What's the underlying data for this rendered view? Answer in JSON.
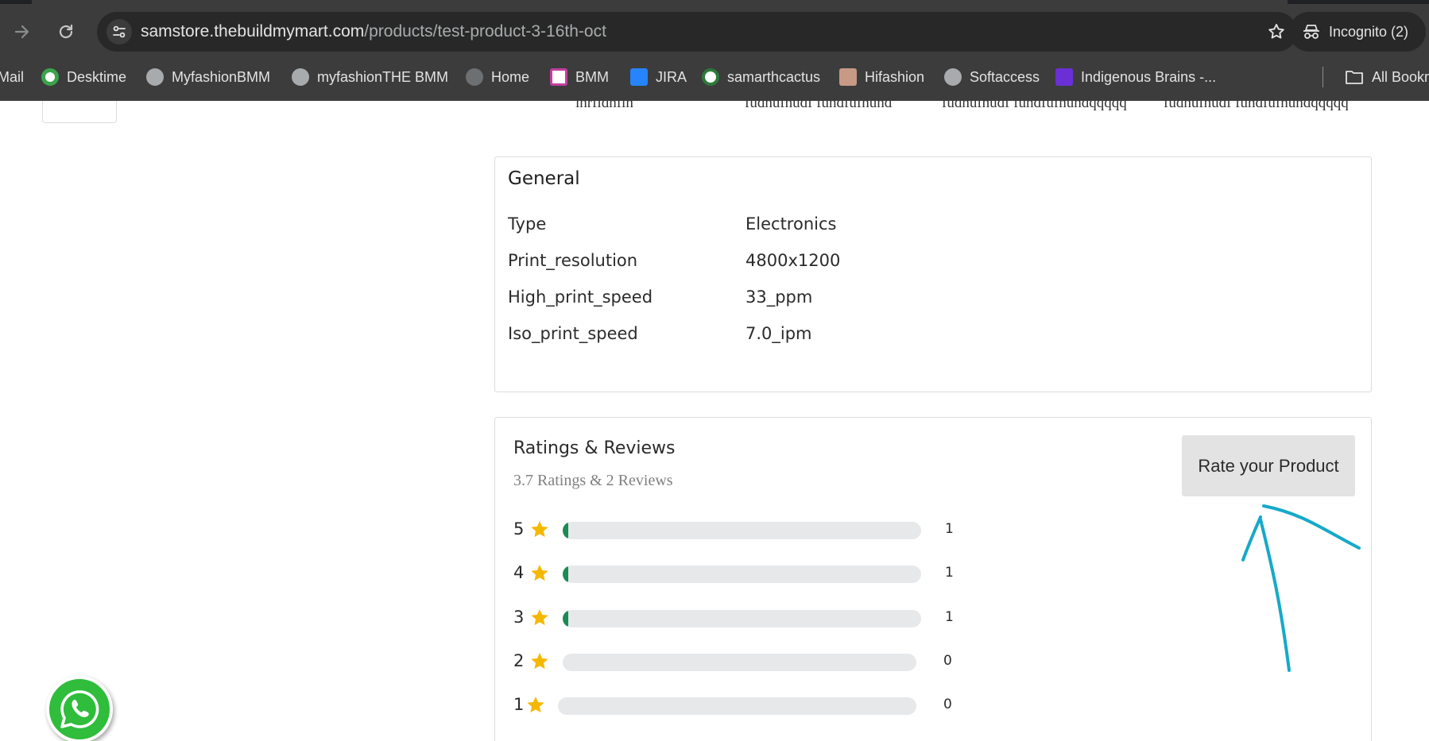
{
  "browser": {
    "url_host": "samstore.thebuildmymart.com",
    "url_path": "/products/test-product-3-16th-oct",
    "incognito_label": "Incognito (2)",
    "bookmarks": [
      {
        "label": "Mail",
        "icon": "mail-icon"
      },
      {
        "label": "Desktime",
        "icon": "desktime-icon"
      },
      {
        "label": "MyfashionBMM",
        "icon": "globe-icon"
      },
      {
        "label": "myfashionTHE BMM",
        "icon": "globe-icon"
      },
      {
        "label": "Home",
        "icon": "globe-icon"
      },
      {
        "label": "BMM",
        "icon": "bmm-icon"
      },
      {
        "label": "JIRA",
        "icon": "jira-icon"
      },
      {
        "label": "samarthcactus",
        "icon": "cactus-icon"
      },
      {
        "label": "Hifashion",
        "icon": "hifashion-icon"
      },
      {
        "label": "Softaccess",
        "icon": "globe-icon"
      },
      {
        "label": "Indigenous Brains -...",
        "icon": "indigenous-icon"
      },
      {
        "label": "All Bookm",
        "icon": "folder-icon"
      }
    ]
  },
  "cut_row": {
    "c1": "ihrfidhfih",
    "c2": "fudhufhudf fuhdfufhuhd",
    "c3": "fudhufhudf fuhdfufhuhdqqqqq",
    "c4": "fudhufhudf fuhdfufhuhdqqqqq"
  },
  "general": {
    "title": "General",
    "specs": [
      {
        "label": "Type",
        "value": "Electronics"
      },
      {
        "label": "Print_resolution",
        "value": "4800x1200"
      },
      {
        "label": "High_print_speed",
        "value": "33_ppm"
      },
      {
        "label": "Iso_print_speed",
        "value": "7.0_ipm"
      }
    ]
  },
  "ratings": {
    "title": "Ratings & Reviews",
    "summary": "3.7 Ratings & 2 Reviews",
    "button": "Rate your Product",
    "breakdown": [
      {
        "stars": "5",
        "count": "1",
        "fill": 0.005
      },
      {
        "stars": "4",
        "count": "1",
        "fill": 0.005
      },
      {
        "stars": "3",
        "count": "1",
        "fill": 0.005
      },
      {
        "stars": "2",
        "count": "0",
        "fill": 0
      },
      {
        "stars": "1",
        "count": "0",
        "fill": 0
      }
    ]
  },
  "colors": {
    "bar_fill": "#1a8a58",
    "star": "#f5b800",
    "annotation": "#16a9c9",
    "whatsapp": "#2fbd3b"
  }
}
